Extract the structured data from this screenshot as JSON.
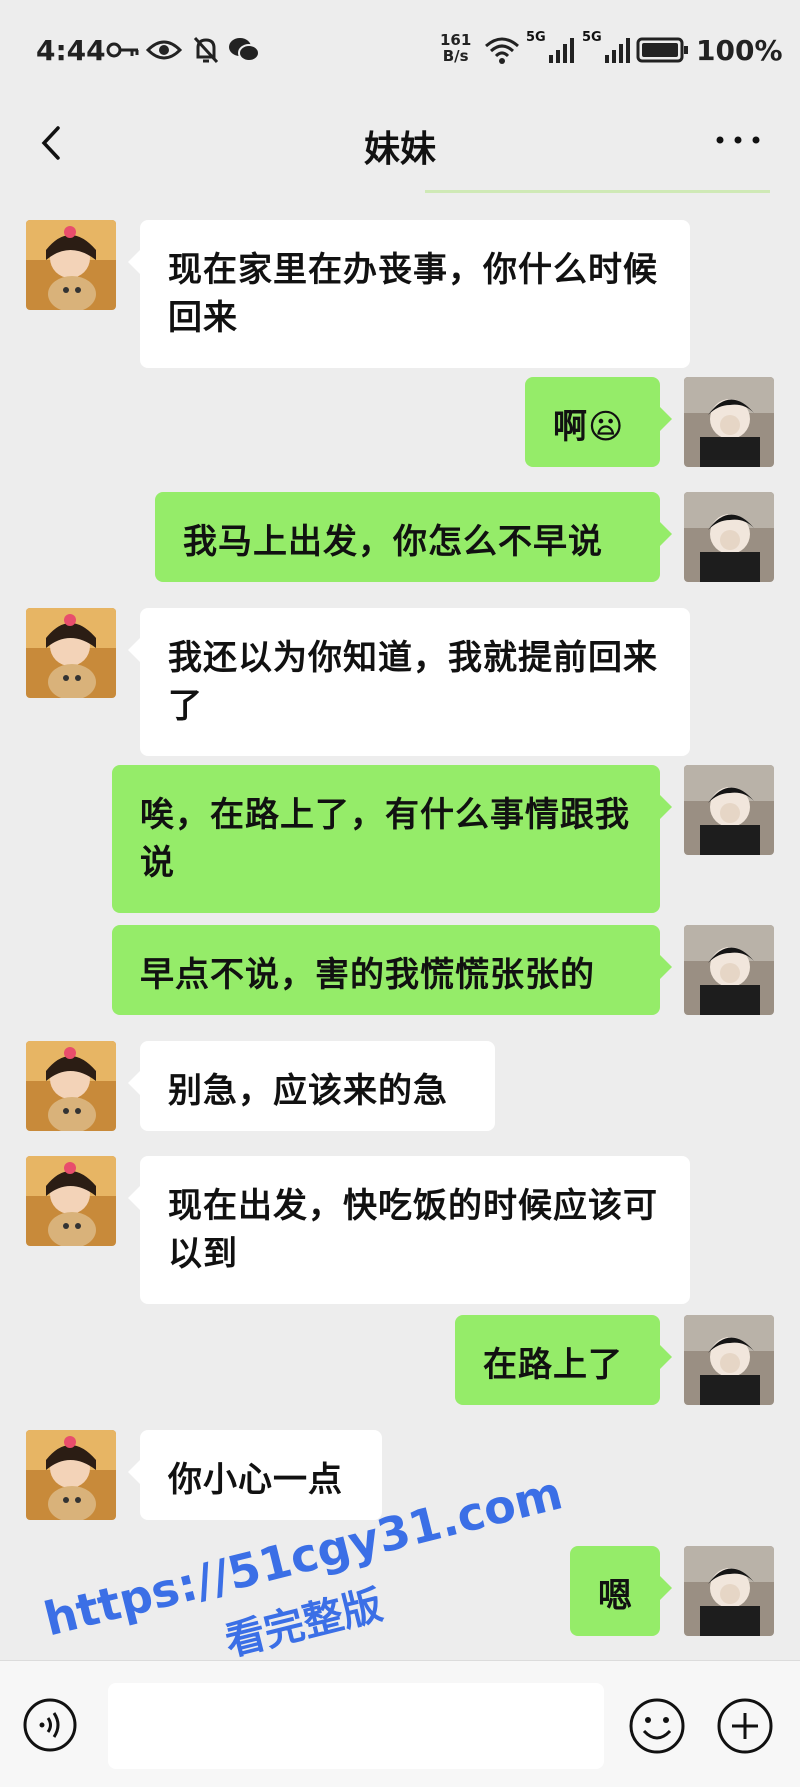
{
  "status_bar": {
    "time": "4:44",
    "net_speed_value": "161",
    "net_speed_unit": "B/s",
    "signal1_label": "5G",
    "signal2_label": "5G",
    "battery_percent": "100%"
  },
  "nav": {
    "title": "妹妹"
  },
  "messages": [
    {
      "side": "left",
      "text": "现在家里在办丧事，你什么时候回来"
    },
    {
      "side": "right",
      "text": "啊😦"
    },
    {
      "side": "right",
      "text": "我马上出发，你怎么不早说"
    },
    {
      "side": "left",
      "text": "我还以为你知道，我就提前回来了"
    },
    {
      "side": "right",
      "text": "唉，在路上了，有什么事情跟我说"
    },
    {
      "side": "right",
      "text": "早点不说，害的我慌慌张张的"
    },
    {
      "side": "left",
      "text": "别急，应该来的急"
    },
    {
      "side": "left",
      "text": "现在出发，快吃饭的时候应该可以到"
    },
    {
      "side": "right",
      "text": "在路上了"
    },
    {
      "side": "left",
      "text": "你小心一点"
    },
    {
      "side": "right",
      "text": "嗯"
    }
  ],
  "input_bar": {
    "value": "",
    "placeholder": ""
  },
  "watermark": {
    "url": "https://51cgy31.com",
    "caption": "看完整版"
  },
  "colors": {
    "background": "#ededed",
    "bubble_self": "#95ec69",
    "bubble_other": "#ffffff",
    "watermark": "#3b6fe6"
  },
  "icons": [
    "key-icon",
    "eye-icon",
    "bell-off-icon",
    "wechat-icon",
    "wifi-icon",
    "signal-icon",
    "battery-icon",
    "back-chevron-icon",
    "more-dots-icon",
    "voice-icon",
    "emoji-icon",
    "plus-icon"
  ]
}
